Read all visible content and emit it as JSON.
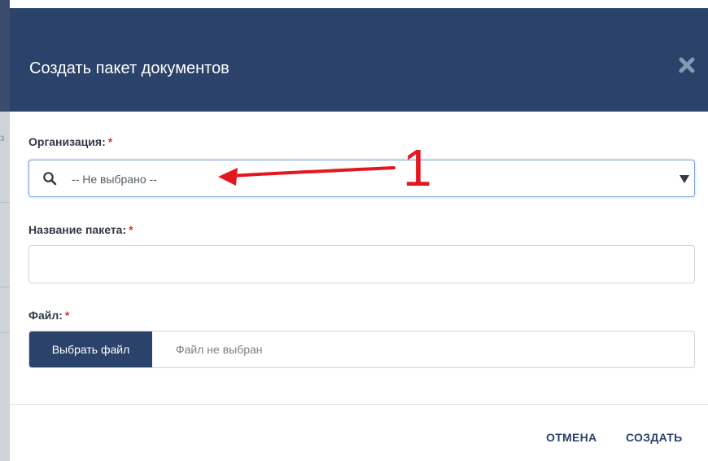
{
  "background": {
    "glyphs": [
      "з"
    ]
  },
  "dialog": {
    "title": "Создать пакет документов",
    "close_icon": "close-icon"
  },
  "form": {
    "organization": {
      "label": "Организация:",
      "required_mark": "*",
      "selected_value": "-- Не выбрано --",
      "icon": "search-icon"
    },
    "package_name": {
      "label": "Название пакета:",
      "required_mark": "*",
      "value": "",
      "placeholder": ""
    },
    "file": {
      "label": "Файл:",
      "required_mark": "*",
      "button_label": "Выбрать файл",
      "status": "Файл не выбран"
    }
  },
  "footer": {
    "cancel_label": "ОТМЕНА",
    "create_label": "СОЗДАТЬ"
  },
  "annotation": {
    "number": "1",
    "color": "#e3171f"
  },
  "colors": {
    "header": "#2b426b",
    "accent": "#2b426b",
    "required": "#d9342b"
  }
}
